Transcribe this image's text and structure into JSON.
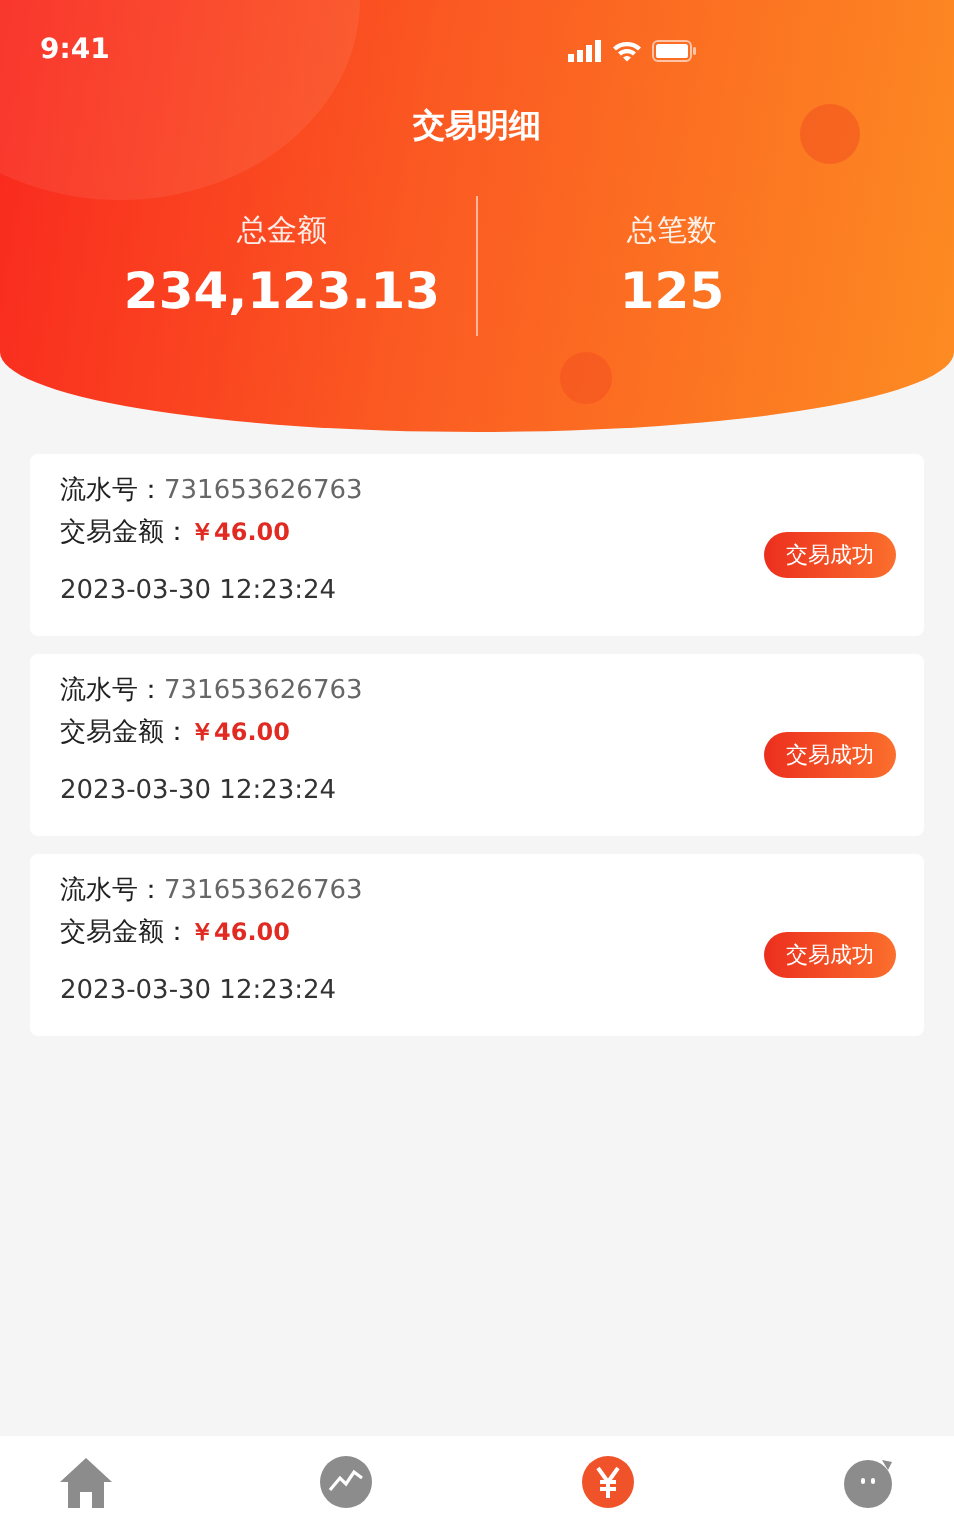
{
  "status_bar": {
    "time": "9:41"
  },
  "header": {
    "title": "交易明细"
  },
  "summary": [
    {
      "label": "总金额",
      "value": "234,123.13"
    },
    {
      "label": "总笔数",
      "value": "125"
    }
  ],
  "transactions": [
    {
      "serial_label": "流水号：",
      "serial": "731653626763",
      "amount_label": "交易金额：",
      "amount": "￥46.00",
      "datetime": "2023-03-30  12:23:24",
      "status": "交易成功"
    },
    {
      "serial_label": "流水号：",
      "serial": "731653626763",
      "amount_label": "交易金额：",
      "amount": "￥46.00",
      "datetime": "2023-03-30  12:23:24",
      "status": "交易成功"
    },
    {
      "serial_label": "流水号：",
      "serial": "731653626763",
      "amount_label": "交易金额：",
      "amount": "￥46.00",
      "datetime": "2023-03-30  12:23:24",
      "status": "交易成功"
    }
  ],
  "tab_bar": [
    {
      "kind": "home",
      "selected": false
    },
    {
      "kind": "chart",
      "selected": false
    },
    {
      "kind": "yen",
      "selected": true
    },
    {
      "kind": "face",
      "selected": false
    }
  ]
}
